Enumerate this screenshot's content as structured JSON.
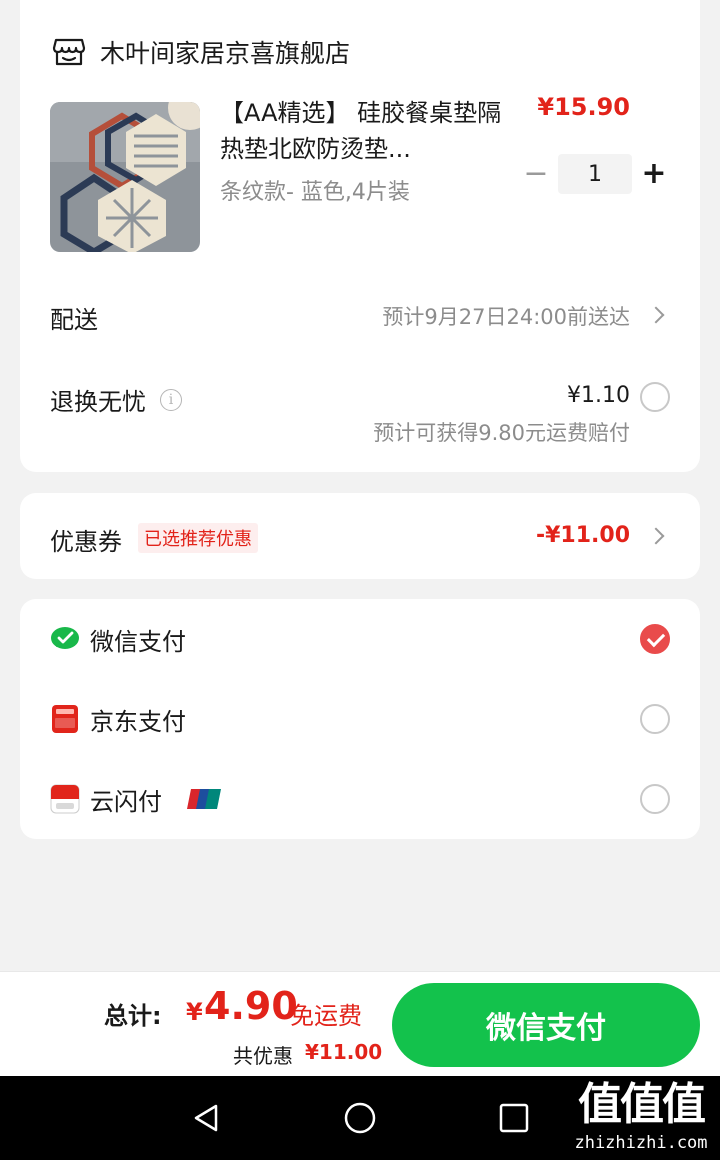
{
  "store": {
    "name": "木叶间家居京喜旗舰店",
    "icon": "store-icon"
  },
  "product": {
    "title": "【AA精选】 硅胶餐桌垫隔热垫北欧防烫垫...",
    "sku": "条纹款- 蓝色,4片装",
    "price": "¥15.90",
    "quantity": "1",
    "minus_label": "−",
    "plus_label": "+"
  },
  "delivery": {
    "label": "配送",
    "value": "预计9月27日24:00前送达"
  },
  "return_service": {
    "label": "退换无忧",
    "info_icon": "i",
    "price": "¥1.10",
    "note": "预计可获得9.80元运费赔付",
    "selected": false
  },
  "coupon": {
    "label": "优惠券",
    "tag": "已选推荐优惠",
    "value": "-¥11.00"
  },
  "payment_methods": [
    {
      "label": "微信支付",
      "icon": "wechat-pay-icon",
      "selected": true
    },
    {
      "label": "京东支付",
      "icon": "jd-pay-icon",
      "selected": false
    },
    {
      "label": "云闪付",
      "icon": "quickpass-icon",
      "selected": false
    }
  ],
  "bottom_bar": {
    "total_label": "总计:",
    "currency": "¥",
    "total_amount": "4.90",
    "free_shipping": "免运费",
    "saved_label": "共优惠",
    "saved_value": "¥11.00",
    "pay_button": "微信支付"
  },
  "watermark": {
    "mark": "值值值",
    "text": "zhizhizhi.com"
  },
  "colors": {
    "accent_red": "#e2231a",
    "pay_green": "#13c24c",
    "radio_checked": "#e94b4b",
    "background": "#f2f2f2"
  }
}
